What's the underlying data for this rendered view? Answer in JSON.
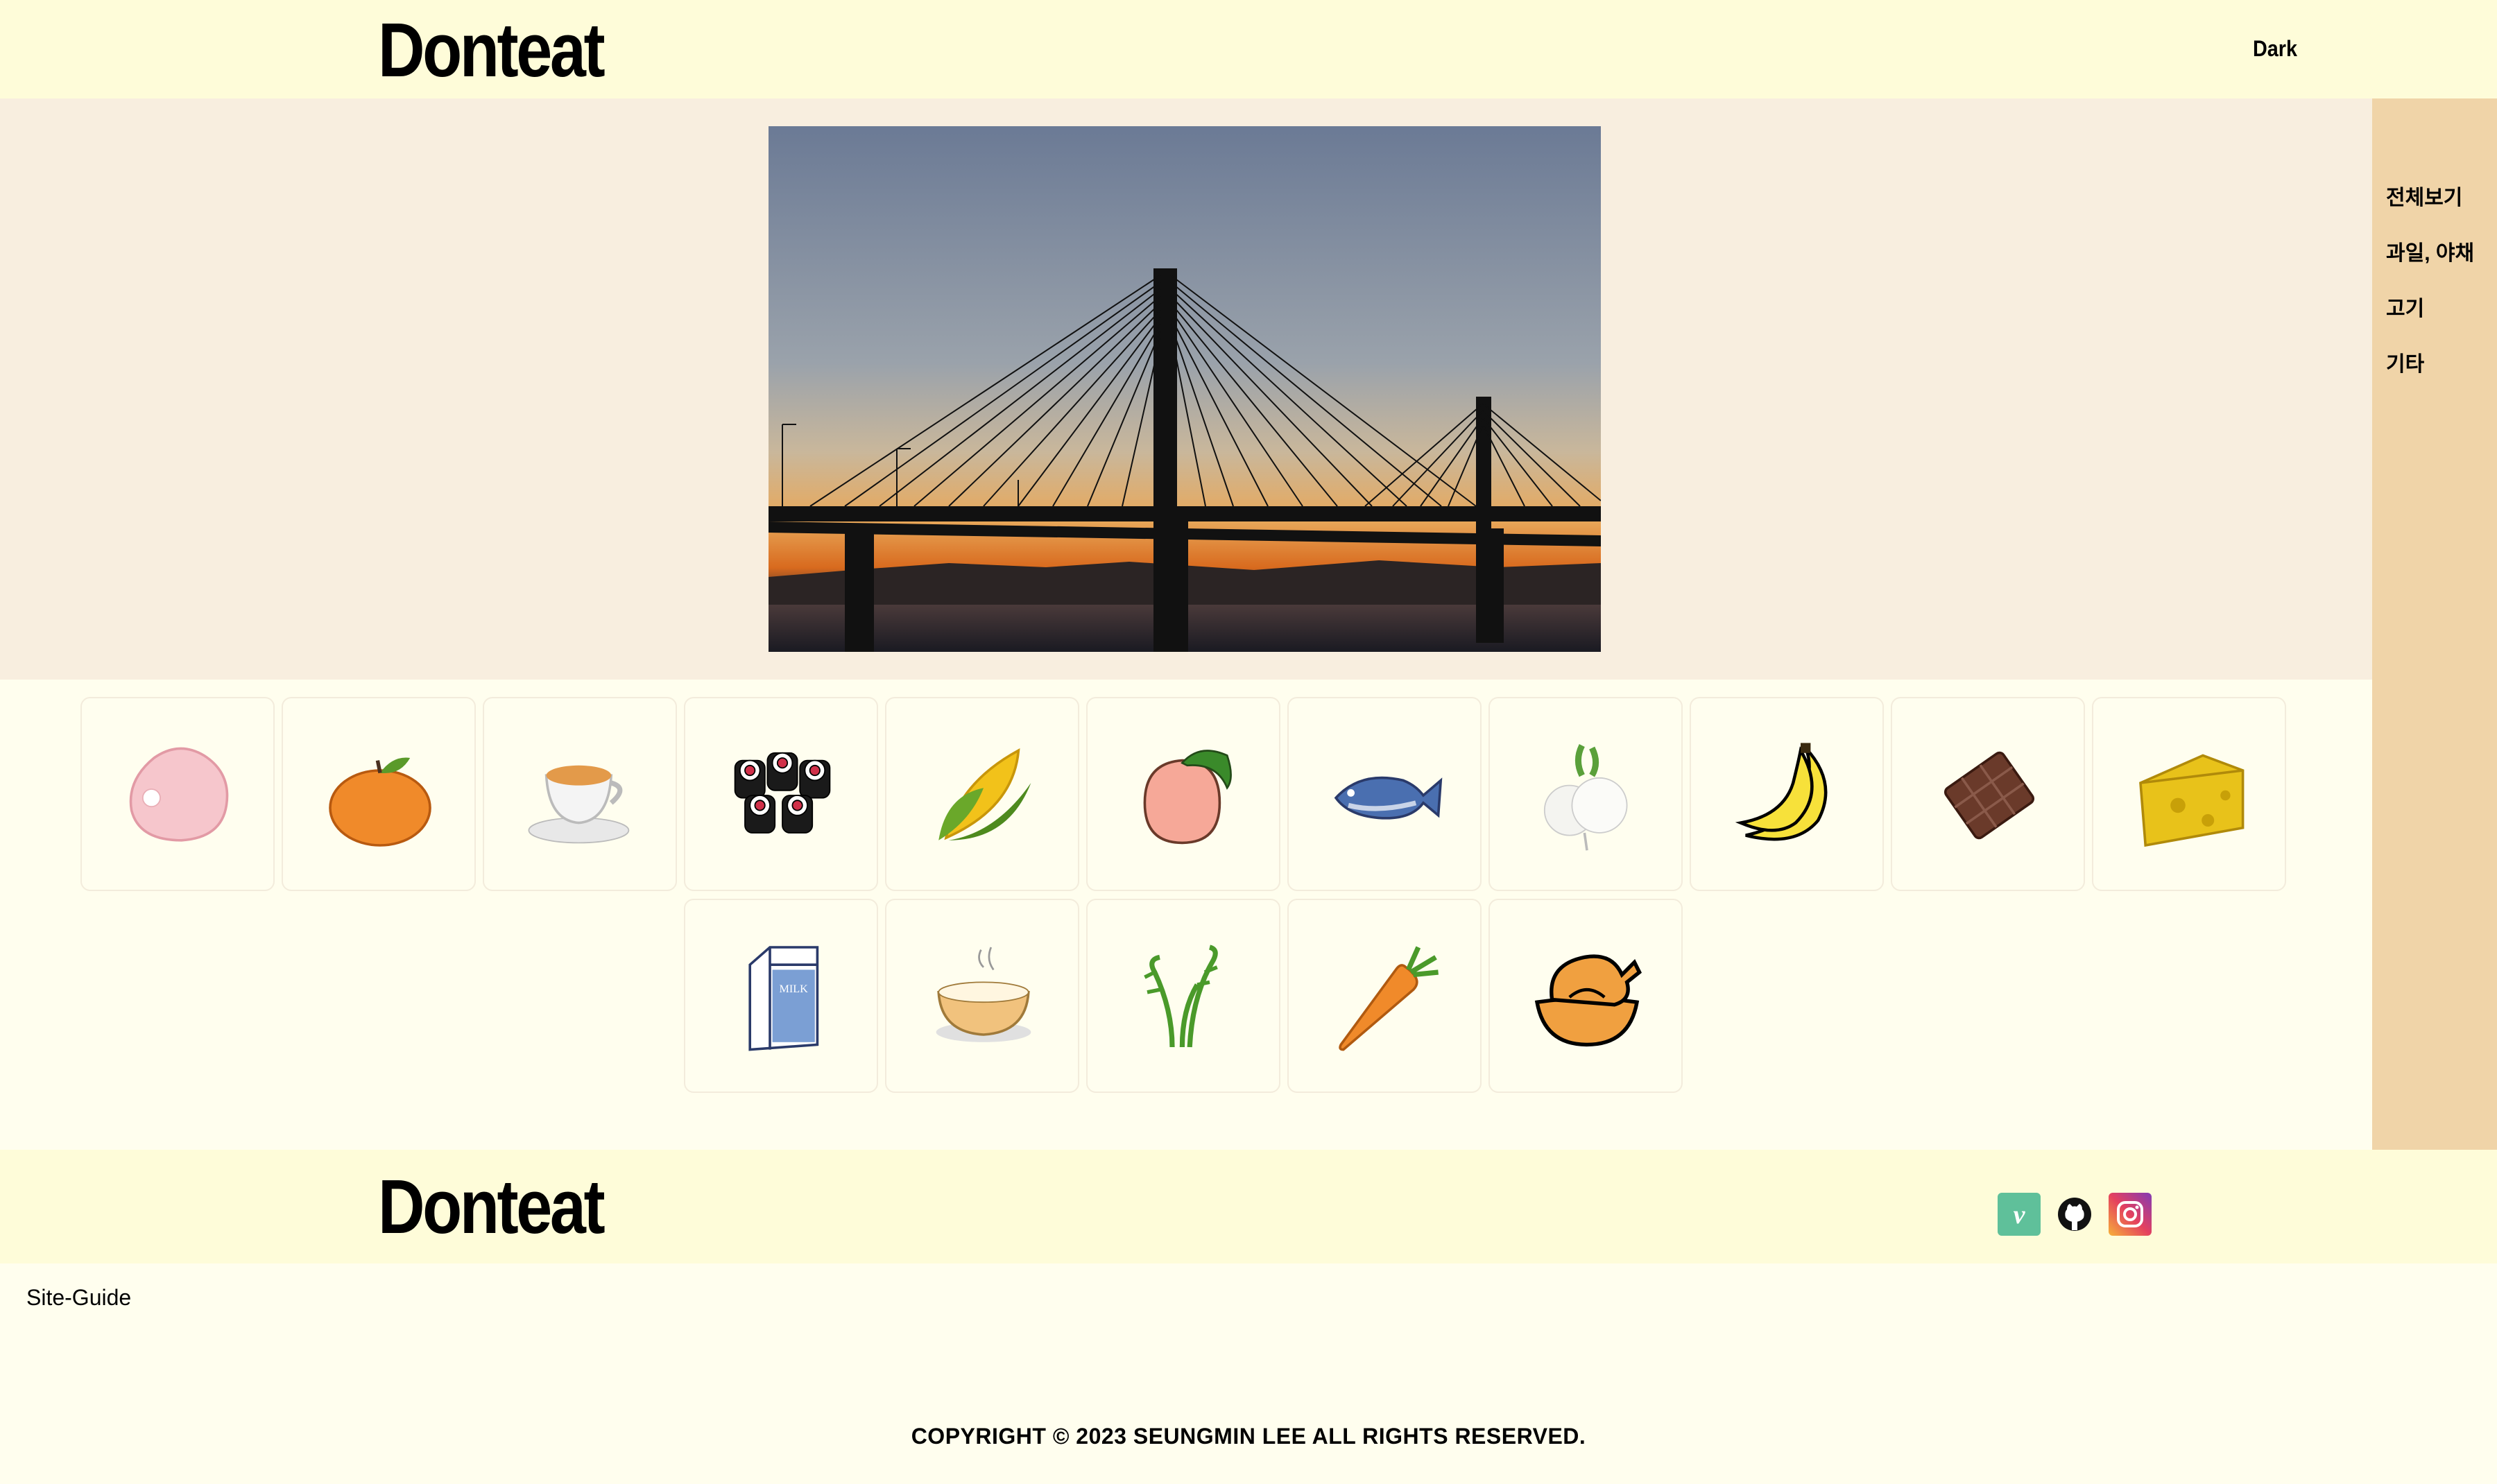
{
  "header": {
    "logo": "Donteat",
    "theme_toggle": "Dark"
  },
  "hero": {
    "image": "bridge-sunset-photo"
  },
  "sidebar": {
    "items": [
      {
        "label": "전체보기"
      },
      {
        "label": "과일, 야채"
      },
      {
        "label": "고기"
      },
      {
        "label": "기타"
      }
    ]
  },
  "foods": [
    {
      "icon": "ham-icon"
    },
    {
      "icon": "tangerine-icon"
    },
    {
      "icon": "tea-cup-icon"
    },
    {
      "icon": "sushi-roll-icon"
    },
    {
      "icon": "corn-icon"
    },
    {
      "icon": "peach-icon"
    },
    {
      "icon": "fish-icon"
    },
    {
      "icon": "turnip-icon"
    },
    {
      "icon": "banana-icon"
    },
    {
      "icon": "chocolate-icon"
    },
    {
      "icon": "cheese-icon"
    },
    {
      "icon": "milk-carton-icon"
    },
    {
      "icon": "soup-bowl-icon"
    },
    {
      "icon": "fern-brake-icon"
    },
    {
      "icon": "carrot-icon"
    },
    {
      "icon": "roast-chicken-icon"
    }
  ],
  "milk_text": "MILK",
  "footer": {
    "logo": "Donteat",
    "social": [
      "velog-icon",
      "github-icon",
      "instagram-icon"
    ],
    "velog_letter": "v",
    "site_guide": "Site-Guide",
    "copyright": "COPYRIGHT © 2023 SEUNGMIN LEE ALL RIGHTS RESERVED."
  },
  "colors": {
    "header_bg": "#fefcd9",
    "hero_bg": "#f8eedf",
    "sidebar_bg": "#f0d4a8",
    "page_bg": "#fffeee",
    "velog_green": "#20c997"
  }
}
